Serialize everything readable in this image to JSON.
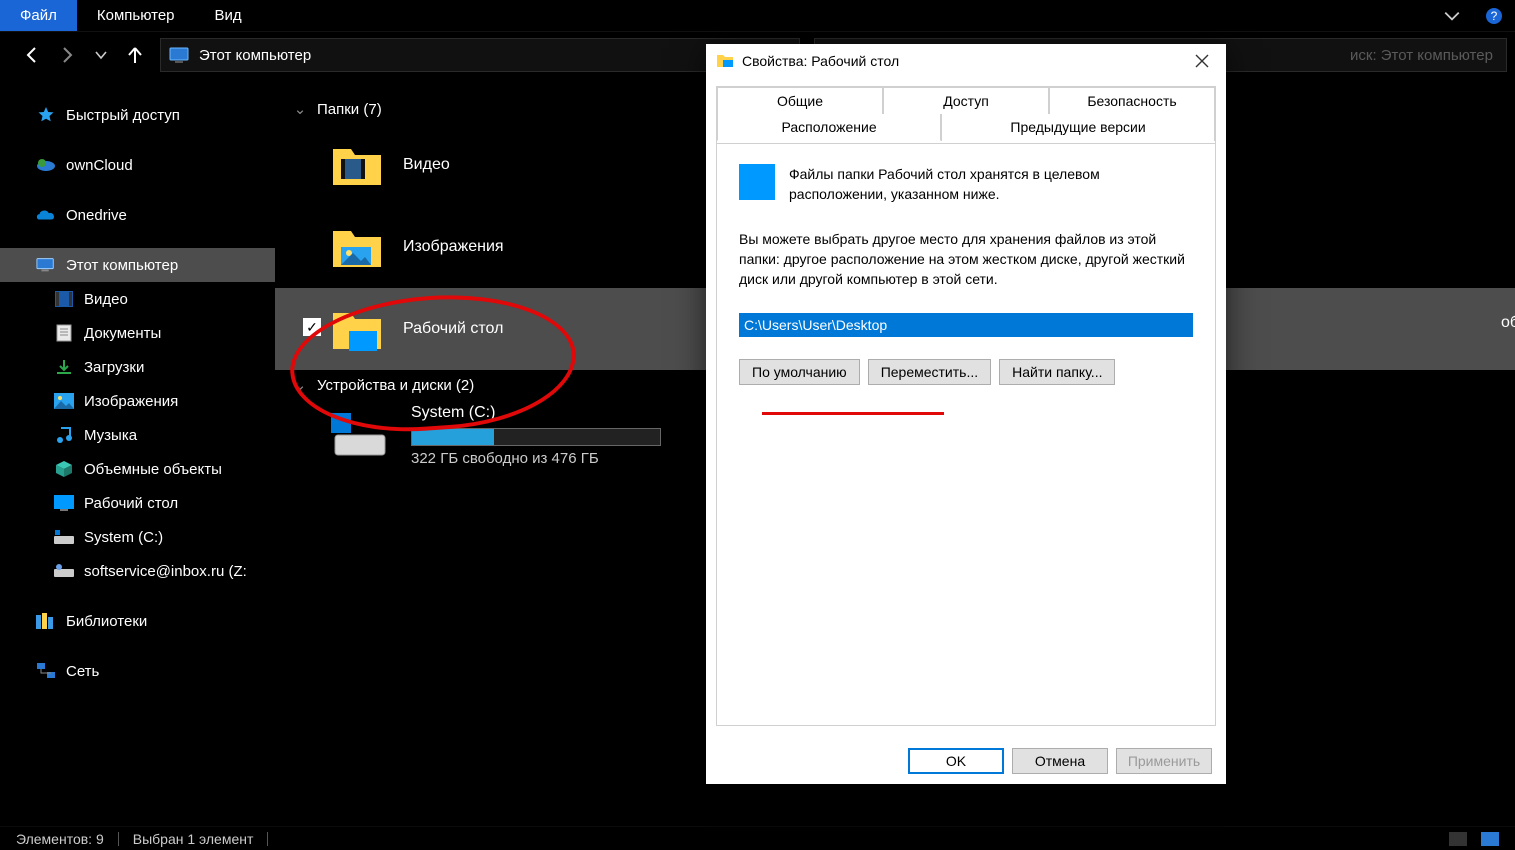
{
  "menu": {
    "file": "Файл",
    "computer": "Компьютер",
    "view": "Вид"
  },
  "address": "Этот компьютер",
  "search_placeholder": "иск: Этот компьютер",
  "sidebar": {
    "quick": "Быстрый доступ",
    "owncloud": "ownCloud",
    "onedrive": "Onedrive",
    "thispc": "Этот компьютер",
    "video": "Видео",
    "documents": "Документы",
    "downloads": "Загрузки",
    "pictures": "Изображения",
    "music": "Музыка",
    "objects3d": "Объемные объекты",
    "desktop": "Рабочий стол",
    "systemc": "System (C:)",
    "softservice": "softservice@inbox.ru (Z:",
    "libraries": "Библиотеки",
    "network": "Сеть"
  },
  "groups": {
    "folders": "Папки (7)",
    "devices": "Устройства и диски (2)"
  },
  "items": {
    "video": "Видео",
    "pictures": "Изображения",
    "desktop": "Рабочий стол"
  },
  "drive": {
    "name": "System (C:)",
    "free": "322 ГБ свободно из 476 ГБ"
  },
  "right_clip": "объекты",
  "status": {
    "count": "Элементов: 9",
    "selected": "Выбран 1 элемент"
  },
  "dialog": {
    "title": "Свойства: Рабочий стол",
    "tabs": {
      "general": "Общие",
      "sharing": "Доступ",
      "security": "Безопасность",
      "location": "Расположение",
      "prev": "Предыдущие версии"
    },
    "line1": "Файлы папки Рабочий стол хранятся в целевом расположении, указанном ниже.",
    "line2": "Вы можете выбрать другое место для хранения файлов из этой папки: другое расположение на этом жестком диске, другой жесткий диск или другой компьютер в этой сети.",
    "path": "C:\\Users\\User\\Desktop",
    "btn_default": "По умолчанию",
    "btn_move": "Переместить...",
    "btn_find": "Найти папку...",
    "ok": "OK",
    "cancel": "Отмена",
    "apply": "Применить"
  }
}
